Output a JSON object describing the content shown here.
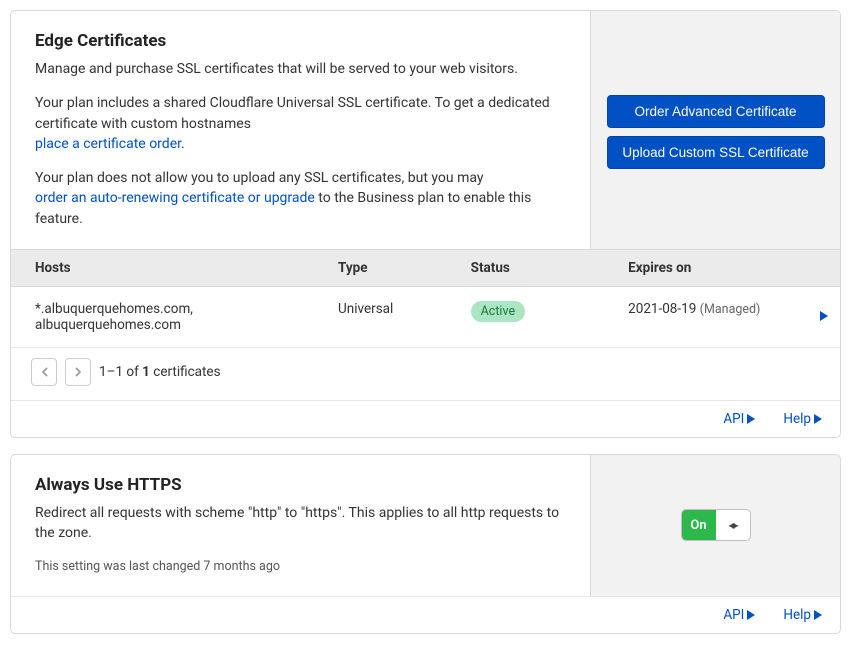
{
  "edge": {
    "title": "Edge Certificates",
    "subtitle": "Manage and purchase SSL certificates that will be served to your web visitors.",
    "plan_text_pre": "Your plan includes a shared Cloudflare Universal SSL certificate. To get a dedicated certificate with custom hostnames",
    "plan_link": "place a certificate order",
    "upload_text_pre": "Your plan does not allow you to upload any SSL certificates, but you may",
    "upload_link": "order an auto-renewing certificate or upgrade",
    "upload_text_post": " to the Business plan to enable this feature.",
    "order_btn": "Order Advanced Certificate",
    "upload_btn": "Upload Custom SSL Certificate",
    "columns": {
      "hosts": "Hosts",
      "type": "Type",
      "status": "Status",
      "expires": "Expires on"
    },
    "rows": [
      {
        "hosts": "*.albuquerquehomes.com, albuquerquehomes.com",
        "type": "Universal",
        "status": "Active",
        "expires": "2021-08-19",
        "expires_note": "(Managed)"
      }
    ],
    "pager": {
      "range": "1–1",
      "of": "of",
      "total": "1",
      "label": "certificates"
    }
  },
  "https": {
    "title": "Always Use HTTPS",
    "desc": "Redirect all requests with scheme \"http\" to \"https\". This applies to all http requests to the zone.",
    "changed": "This setting was last changed 7 months ago",
    "toggle": "On"
  },
  "footer": {
    "api": "API",
    "help": "Help"
  }
}
